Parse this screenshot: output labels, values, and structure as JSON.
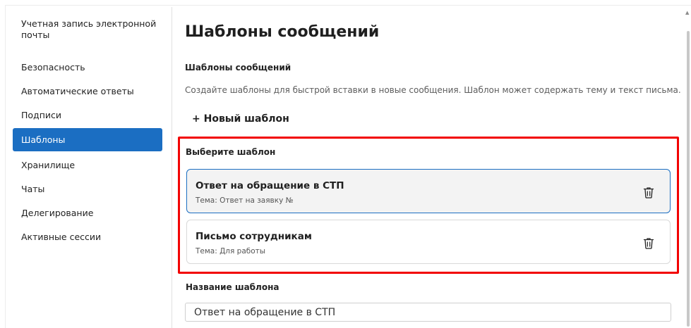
{
  "sidebar": {
    "items": [
      {
        "label": "Учетная запись электронной почты",
        "active": false
      },
      {
        "label": "Безопасность",
        "active": false
      },
      {
        "label": "Автоматические ответы",
        "active": false
      },
      {
        "label": "Подписи",
        "active": false
      },
      {
        "label": "Шаблоны",
        "active": true
      },
      {
        "label": "Хранилище",
        "active": false
      },
      {
        "label": "Чаты",
        "active": false
      },
      {
        "label": "Делегирование",
        "active": false
      },
      {
        "label": "Активные сессии",
        "active": false
      }
    ]
  },
  "main": {
    "title": "Шаблоны сообщений",
    "section_title": "Шаблоны сообщений",
    "description": "Создайте шаблоны для быстрой вставки в новые сообщения. Шаблон может содержать тему и текст письма.",
    "new_template_button": "+ Новый шаблон",
    "choose_label": "Выберите шаблон",
    "templates": [
      {
        "title": "Ответ на обращение в СТП",
        "subject": "Тема: Ответ на заявку №",
        "selected": true
      },
      {
        "title": "Письмо сотрудникам",
        "subject": "Тема: Для работы",
        "selected": false
      }
    ],
    "name_label": "Название шаблона",
    "name_value": "Ответ на обращение в СТП"
  },
  "icons": {
    "delete": "trash-icon",
    "scroll_up": "chevron-up-icon"
  },
  "colors": {
    "accent": "#1b6ec2",
    "highlight": "#f20000",
    "selected_card_bg": "#f3f3f3"
  }
}
